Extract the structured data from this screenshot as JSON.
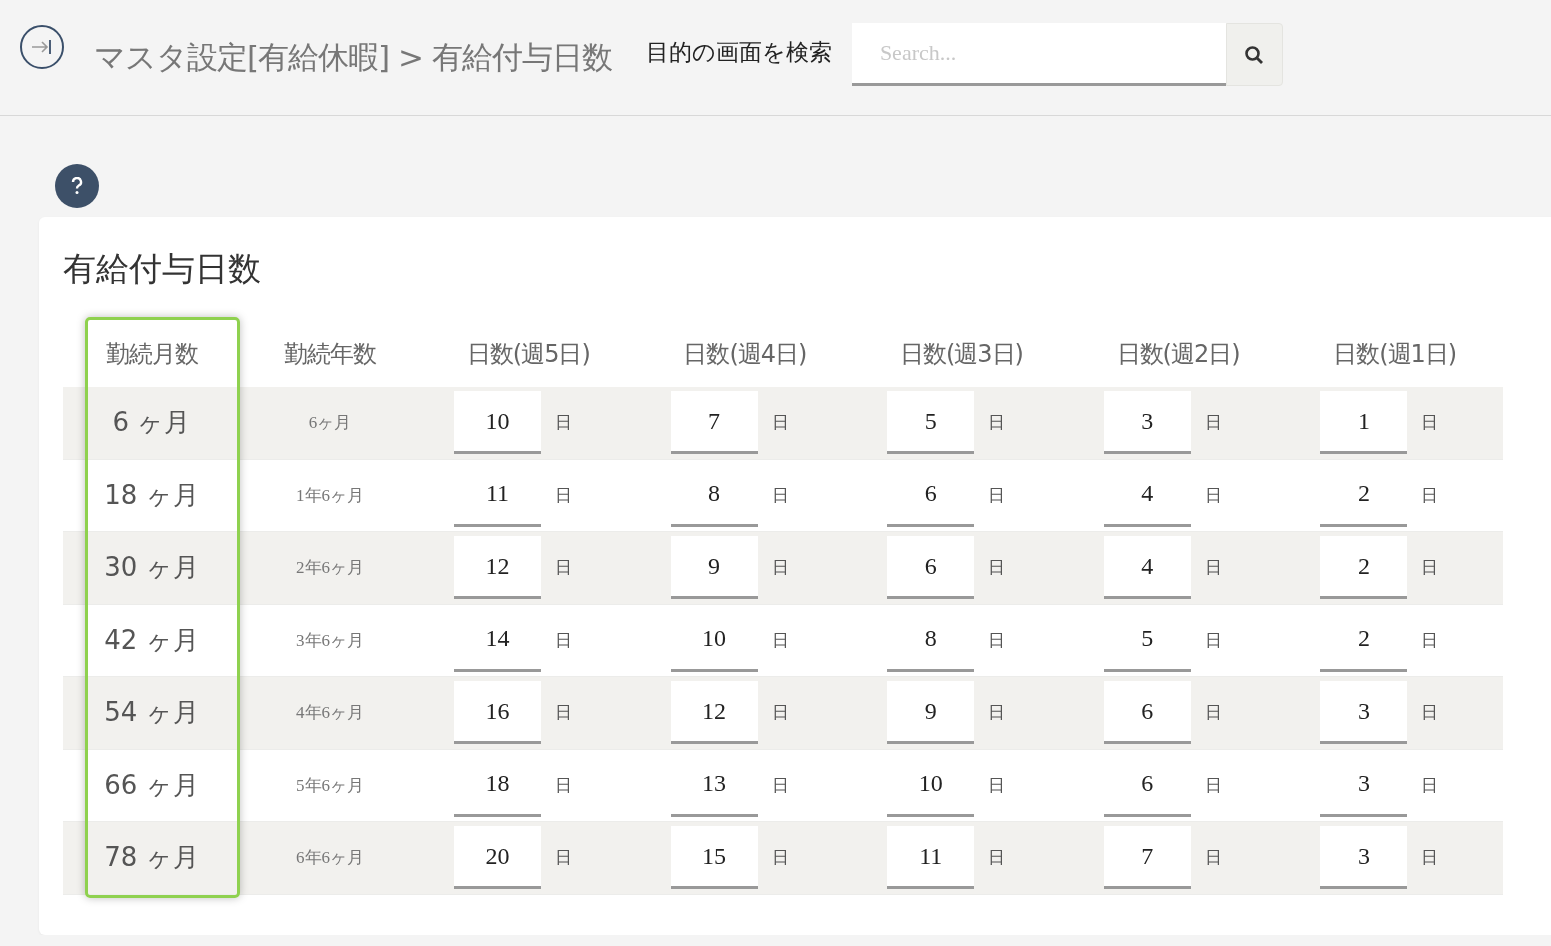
{
  "header": {
    "breadcrumb": "マスタ設定[有給休暇] > 有給付与日数",
    "search_label": "目的の画面を検索",
    "search": {
      "placeholder": "Search..."
    }
  },
  "card": {
    "title": "有給付与日数"
  },
  "columns": [
    {
      "label": "勤続月数",
      "highlighted": true
    },
    {
      "label": "勤続年数",
      "highlighted": false
    },
    {
      "label": "日数(週5日)",
      "highlighted": false
    },
    {
      "label": "日数(週4日)",
      "highlighted": false
    },
    {
      "label": "日数(週3日)",
      "highlighted": false
    },
    {
      "label": "日数(週2日)",
      "highlighted": false
    },
    {
      "label": "日数(週1日)",
      "highlighted": false
    }
  ],
  "rows": [
    {
      "months": "6 ヶ月",
      "years": "6ヶ月",
      "days": [
        {
          "value": "10",
          "unit": "日"
        },
        {
          "value": "7",
          "unit": "日"
        },
        {
          "value": "5",
          "unit": "日"
        },
        {
          "value": "3",
          "unit": "日"
        },
        {
          "value": "1",
          "unit": "日"
        }
      ]
    },
    {
      "months": "18 ヶ月",
      "years": "1年6ヶ月",
      "days": [
        {
          "value": "11",
          "unit": "日"
        },
        {
          "value": "8",
          "unit": "日"
        },
        {
          "value": "6",
          "unit": "日"
        },
        {
          "value": "4",
          "unit": "日"
        },
        {
          "value": "2",
          "unit": "日"
        }
      ]
    },
    {
      "months": "30 ヶ月",
      "years": "2年6ヶ月",
      "days": [
        {
          "value": "12",
          "unit": "日"
        },
        {
          "value": "9",
          "unit": "日"
        },
        {
          "value": "6",
          "unit": "日"
        },
        {
          "value": "4",
          "unit": "日"
        },
        {
          "value": "2",
          "unit": "日"
        }
      ]
    },
    {
      "months": "42 ヶ月",
      "years": "3年6ヶ月",
      "days": [
        {
          "value": "14",
          "unit": "日"
        },
        {
          "value": "10",
          "unit": "日"
        },
        {
          "value": "8",
          "unit": "日"
        },
        {
          "value": "5",
          "unit": "日"
        },
        {
          "value": "2",
          "unit": "日"
        }
      ]
    },
    {
      "months": "54 ヶ月",
      "years": "4年6ヶ月",
      "days": [
        {
          "value": "16",
          "unit": "日"
        },
        {
          "value": "12",
          "unit": "日"
        },
        {
          "value": "9",
          "unit": "日"
        },
        {
          "value": "6",
          "unit": "日"
        },
        {
          "value": "3",
          "unit": "日"
        }
      ]
    },
    {
      "months": "66 ヶ月",
      "years": "5年6ヶ月",
      "days": [
        {
          "value": "18",
          "unit": "日"
        },
        {
          "value": "13",
          "unit": "日"
        },
        {
          "value": "10",
          "unit": "日"
        },
        {
          "value": "6",
          "unit": "日"
        },
        {
          "value": "3",
          "unit": "日"
        }
      ]
    },
    {
      "months": "78 ヶ月",
      "years": "6年6ヶ月",
      "days": [
        {
          "value": "20",
          "unit": "日"
        },
        {
          "value": "15",
          "unit": "日"
        },
        {
          "value": "11",
          "unit": "日"
        },
        {
          "value": "7",
          "unit": "日"
        },
        {
          "value": "3",
          "unit": "日"
        }
      ]
    }
  ]
}
